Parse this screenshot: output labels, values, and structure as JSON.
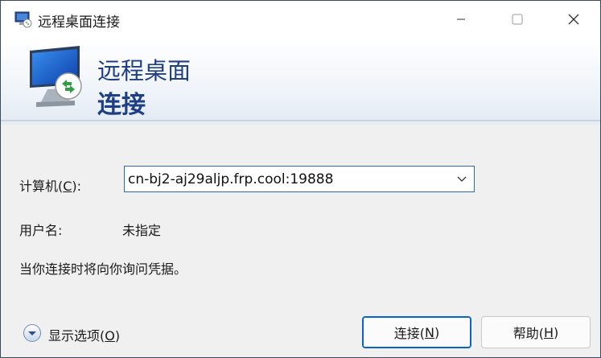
{
  "window": {
    "title": "远程桌面连接"
  },
  "banner": {
    "line1": "远程桌面",
    "line2": "连接"
  },
  "form": {
    "computer_label_pre": "计算机(",
    "computer_label_key": "C",
    "computer_label_post": "):",
    "computer_value": "cn-bj2-aj29aljp.frp.cool:19888",
    "username_label": "用户名:",
    "username_value": "未指定",
    "info_text": "当你连接时将向你询问凭据。"
  },
  "footer": {
    "options_pre": "显示选项(",
    "options_key": "O",
    "options_post": ")",
    "connect_pre": "连接(",
    "connect_key": "N",
    "connect_post": ")",
    "help_pre": "帮助(",
    "help_key": "H",
    "help_post": ")"
  },
  "colors": {
    "banner_text": "#1f3f84",
    "accent": "#0a63c8"
  },
  "icons": [
    "rdp-app-icon",
    "minimize-icon",
    "maximize-icon",
    "close-icon",
    "rdp-monitor-icon",
    "chevron-down-icon",
    "expand-options-icon"
  ]
}
